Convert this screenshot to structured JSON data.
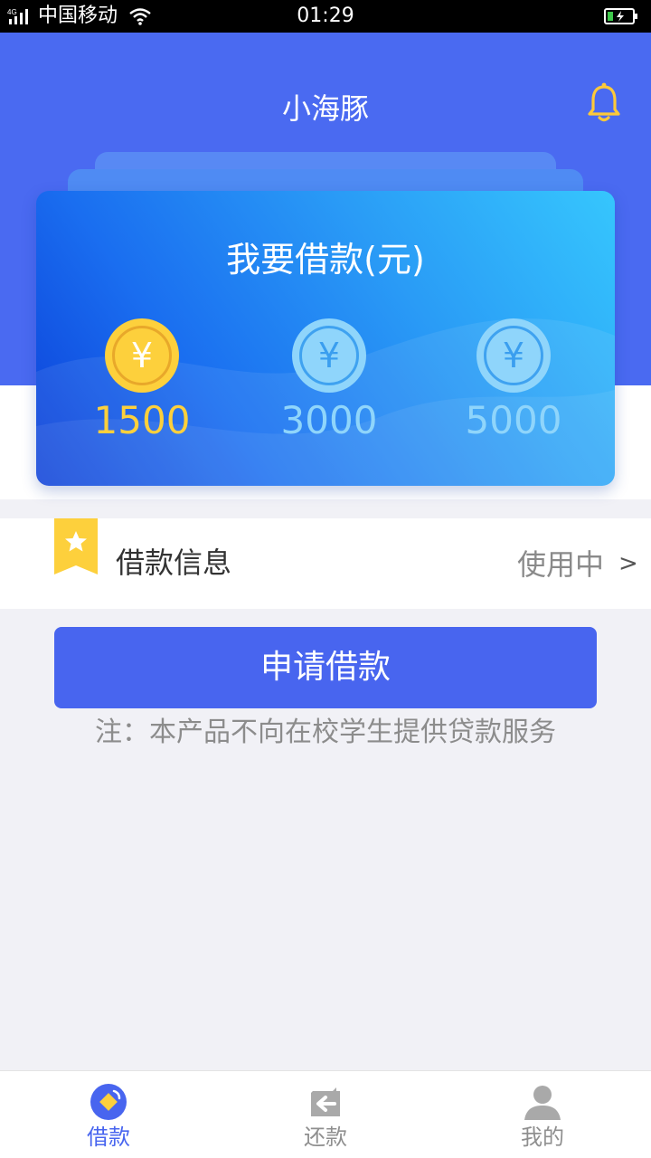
{
  "status_bar": {
    "network": "4G",
    "carrier": "中国移动",
    "time": "01:29"
  },
  "header": {
    "title": "小海豚",
    "bell_icon": "bell-icon"
  },
  "loan_card": {
    "title": "我要借款(元)",
    "currency_symbol": "¥",
    "amounts": [
      {
        "value": "1500",
        "selected": true
      },
      {
        "value": "3000",
        "selected": false
      },
      {
        "value": "5000",
        "selected": false
      }
    ]
  },
  "info_row": {
    "label": "借款信息",
    "status": "使用中",
    "arrow": ">"
  },
  "apply_button": {
    "label": "申请借款"
  },
  "note": "注：本产品不向在校学生提供贷款服务",
  "tabbar": {
    "tabs": [
      {
        "label": "借款",
        "icon": "loan-icon",
        "active": true
      },
      {
        "label": "还款",
        "icon": "repay-icon",
        "active": false
      },
      {
        "label": "我的",
        "icon": "profile-icon",
        "active": false
      }
    ]
  },
  "colors": {
    "primary": "#4865ef",
    "header_bg": "#4a6af1",
    "accent_gold": "#fdd03c",
    "coin_light": "#8fd5fb",
    "background": "#f1f1f6"
  }
}
